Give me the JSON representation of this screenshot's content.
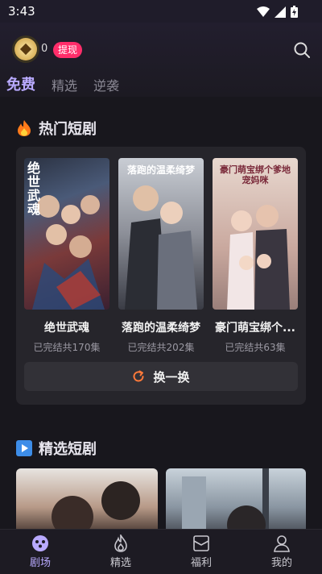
{
  "status": {
    "time": "3:43"
  },
  "header": {
    "coins": "0",
    "withdraw_label": "提现"
  },
  "tabs": [
    {
      "label": "免费",
      "active": true
    },
    {
      "label": "精选",
      "active": false
    },
    {
      "label": "逆袭",
      "active": false
    }
  ],
  "hot": {
    "title": "热门短剧",
    "items": [
      {
        "title": "绝世武魂",
        "subtitle": "已完结共170集",
        "poster_text": "绝世武魂"
      },
      {
        "title": "落跑的温柔绮梦",
        "subtitle": "已完结共202集",
        "poster_text": "落跑的温柔绮梦"
      },
      {
        "title": "豪门萌宝绑个...",
        "subtitle": "已完结共63集",
        "poster_text": "豪门萌宝绑个爹地宠妈咪"
      }
    ],
    "swap_label": "换一换"
  },
  "picks": {
    "title": "精选短剧"
  },
  "nav": [
    {
      "label": "剧场",
      "icon": "theater-icon",
      "active": true
    },
    {
      "label": "精选",
      "icon": "flame-icon",
      "active": false
    },
    {
      "label": "福利",
      "icon": "gift-icon",
      "active": false
    },
    {
      "label": "我的",
      "icon": "profile-icon",
      "active": false
    }
  ],
  "colors": {
    "accent": "#b9aaff",
    "badge": "#ff2d6a"
  }
}
